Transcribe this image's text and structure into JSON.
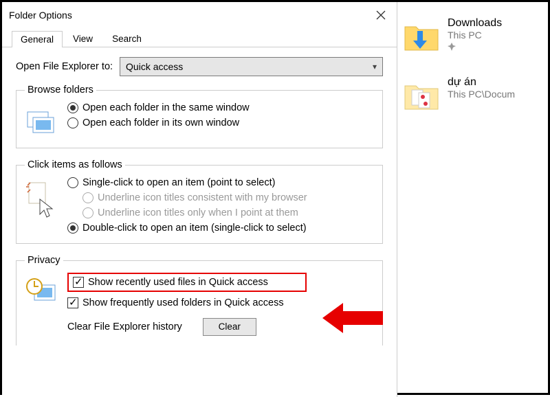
{
  "dialog": {
    "title": "Folder Options",
    "tabs": {
      "general": "General",
      "view": "View",
      "search": "Search"
    },
    "open_to_label": "Open File Explorer to:",
    "open_to_value": "Quick access",
    "browse": {
      "legend": "Browse folders",
      "same": "Open each folder in the same window",
      "own": "Open each folder in its own window"
    },
    "click": {
      "legend": "Click items as follows",
      "single": "Single-click to open an item (point to select)",
      "ul_browser": "Underline icon titles consistent with my browser",
      "ul_point": "Underline icon titles only when I point at them",
      "double": "Double-click to open an item (single-click to select)"
    },
    "privacy": {
      "legend": "Privacy",
      "recent_files": "Show recently used files in Quick access",
      "freq_folders": "Show frequently used folders in Quick access",
      "clear_label": "Clear File Explorer history",
      "clear_button": "Clear"
    }
  },
  "side": {
    "items": [
      {
        "title": "Downloads",
        "subtitle": "This PC",
        "pinned": true
      },
      {
        "title": "dự án",
        "subtitle": "This PC\\Docum"
      }
    ]
  }
}
